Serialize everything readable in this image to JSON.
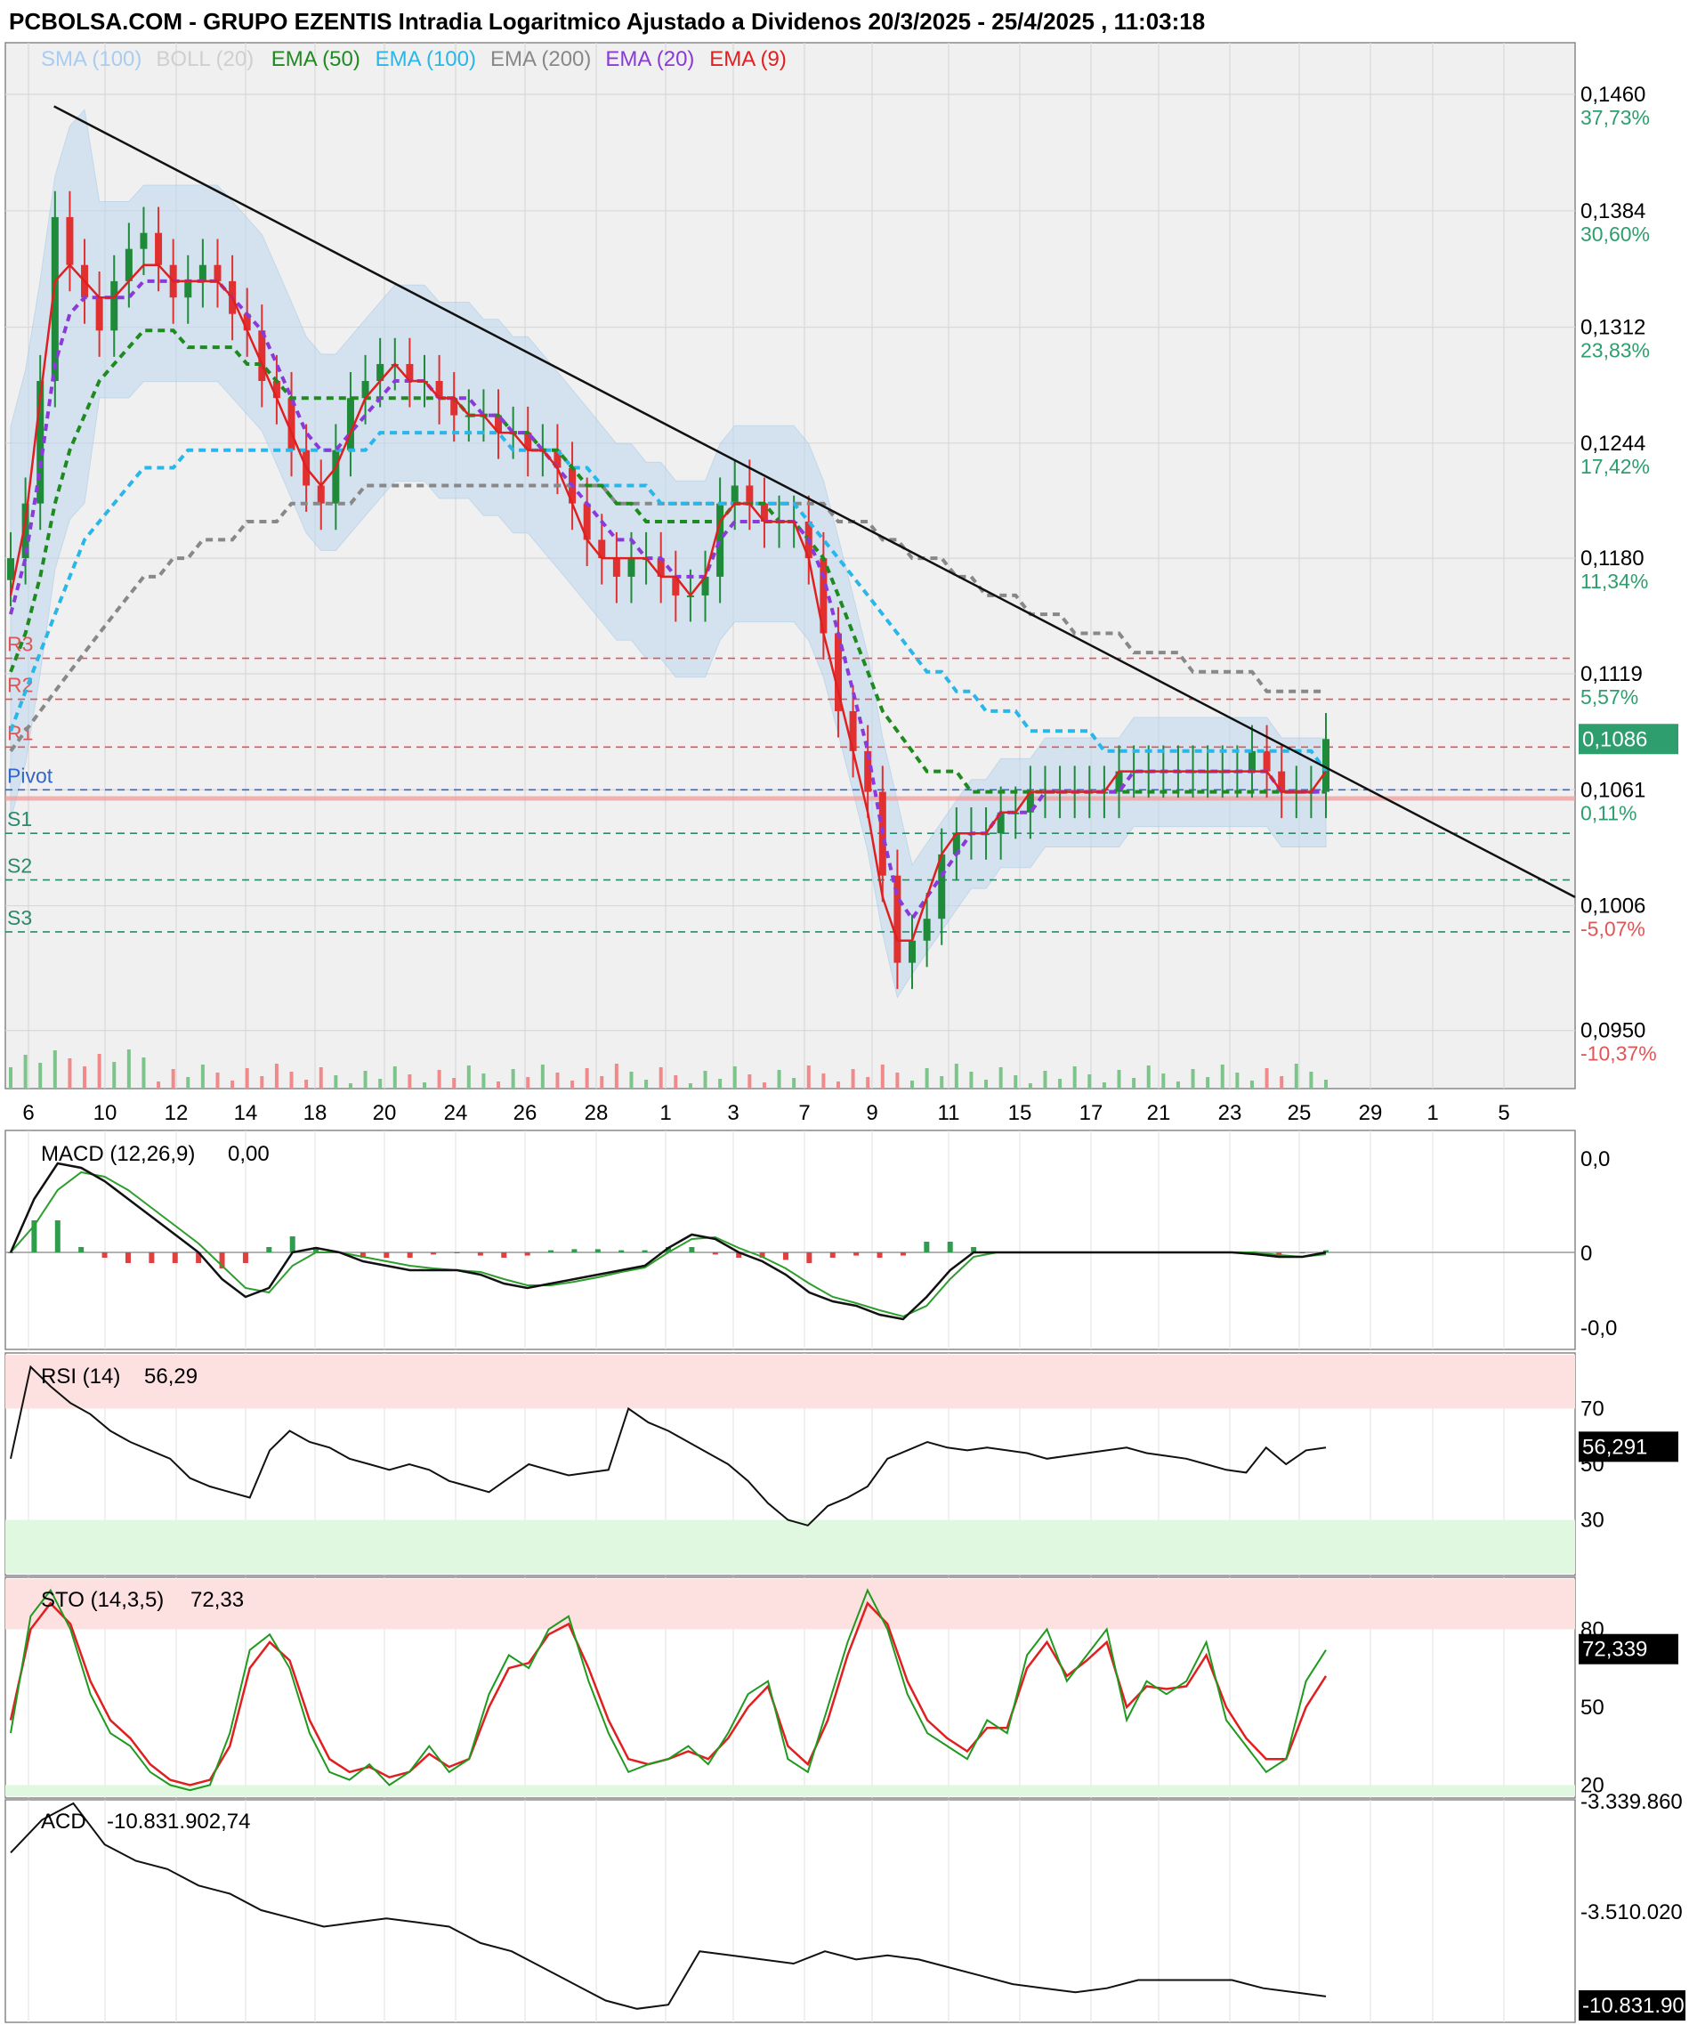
{
  "title": "PCBOLSA.COM - GRUPO EZENTIS Intradia Logaritmico Ajustado a Dividenos 20/3/2025 - 25/4/2025 , 11:03:18",
  "legend": [
    {
      "label": "SMA (100)",
      "color": "#a9cdf0"
    },
    {
      "label": "BOLL (20)",
      "color": "#cfcfcf"
    },
    {
      "label": "EMA (50)",
      "color": "#1f8a1f"
    },
    {
      "label": "EMA (100)",
      "color": "#29b6e8"
    },
    {
      "label": "EMA (200)",
      "color": "#888888"
    },
    {
      "label": "EMA (20)",
      "color": "#8a3ad8"
    },
    {
      "label": "EMA (9)",
      "color": "#e02020"
    }
  ],
  "colors": {
    "up": "#1f8a3a",
    "down": "#e03030",
    "badge": "#2e9e6e",
    "resistance": "#e05555",
    "support": "#2a8a6a",
    "pivot": "#3366cc"
  },
  "chart_data": [
    {
      "type": "candlestick",
      "name": "price",
      "scale": "log",
      "ylim": [
        0.0925,
        0.1495
      ],
      "x_ticks": [
        "6",
        "10",
        "12",
        "14",
        "18",
        "20",
        "24",
        "26",
        "28",
        "1",
        "3",
        "7",
        "9",
        "11",
        "15",
        "17",
        "21",
        "23",
        "25",
        "29",
        "1",
        "5"
      ],
      "y_ticks": [
        {
          "value": "0,1460",
          "pct": "37,73%"
        },
        {
          "value": "0,1384",
          "pct": "30,60%"
        },
        {
          "value": "0,1312",
          "pct": "23,83%"
        },
        {
          "value": "0,1244",
          "pct": "17,42%"
        },
        {
          "value": "0,1180",
          "pct": "11,34%"
        },
        {
          "value": "0,1119",
          "pct": "5,57%"
        },
        {
          "value": "0,1061",
          "pct": "0,11%"
        },
        {
          "value": "0,1006",
          "pct": "-5,07%"
        },
        {
          "value": "0,0950",
          "pct": "-10,37%"
        }
      ],
      "last_price": "0,1086",
      "pivot_levels": [
        {
          "label": "R3",
          "value": 0.1127
        },
        {
          "label": "R2",
          "value": 0.1106
        },
        {
          "label": "R1",
          "value": 0.1082
        },
        {
          "label": "Pivot",
          "value": 0.1061
        },
        {
          "label": "S1",
          "value": 0.104
        },
        {
          "label": "S2",
          "value": 0.1018
        },
        {
          "label": "S3",
          "value": 0.0994
        }
      ],
      "close": [
        0.118,
        0.121,
        0.128,
        0.138,
        0.135,
        0.133,
        0.131,
        0.134,
        0.136,
        0.137,
        0.135,
        0.133,
        0.134,
        0.135,
        0.134,
        0.132,
        0.131,
        0.128,
        0.127,
        0.124,
        0.122,
        0.121,
        0.124,
        0.127,
        0.128,
        0.129,
        0.129,
        0.128,
        0.128,
        0.127,
        0.126,
        0.126,
        0.126,
        0.125,
        0.125,
        0.124,
        0.124,
        0.123,
        0.121,
        0.119,
        0.118,
        0.117,
        0.118,
        0.118,
        0.117,
        0.116,
        0.116,
        0.117,
        0.121,
        0.122,
        0.121,
        0.12,
        0.12,
        0.12,
        0.118,
        0.114,
        0.11,
        0.108,
        0.106,
        0.102,
        0.098,
        0.099,
        0.1,
        0.103,
        0.104,
        0.104,
        0.104,
        0.105,
        0.105,
        0.106,
        0.106,
        0.106,
        0.106,
        0.106,
        0.106,
        0.107,
        0.107,
        0.107,
        0.107,
        0.107,
        0.107,
        0.107,
        0.107,
        0.107,
        0.108,
        0.107,
        0.106,
        0.106,
        0.106,
        0.1086
      ],
      "ema9": [
        0.116,
        0.12,
        0.127,
        0.134,
        0.135,
        0.134,
        0.133,
        0.133,
        0.134,
        0.135,
        0.135,
        0.134,
        0.134,
        0.134,
        0.134,
        0.133,
        0.131,
        0.129,
        0.127,
        0.125,
        0.123,
        0.122,
        0.123,
        0.125,
        0.127,
        0.128,
        0.129,
        0.128,
        0.128,
        0.127,
        0.127,
        0.126,
        0.126,
        0.125,
        0.125,
        0.124,
        0.124,
        0.123,
        0.121,
        0.119,
        0.118,
        0.118,
        0.118,
        0.118,
        0.117,
        0.117,
        0.116,
        0.117,
        0.12,
        0.121,
        0.121,
        0.12,
        0.12,
        0.12,
        0.118,
        0.114,
        0.111,
        0.108,
        0.105,
        0.101,
        0.099,
        0.099,
        0.101,
        0.103,
        0.104,
        0.104,
        0.104,
        0.105,
        0.105,
        0.106,
        0.106,
        0.106,
        0.106,
        0.106,
        0.106,
        0.107,
        0.107,
        0.107,
        0.107,
        0.107,
        0.107,
        0.107,
        0.107,
        0.107,
        0.107,
        0.107,
        0.106,
        0.106,
        0.106,
        0.107
      ],
      "ema20": [
        0.115,
        0.118,
        0.123,
        0.129,
        0.132,
        0.133,
        0.133,
        0.133,
        0.133,
        0.134,
        0.134,
        0.134,
        0.134,
        0.134,
        0.134,
        0.133,
        0.132,
        0.131,
        0.129,
        0.127,
        0.125,
        0.124,
        0.124,
        0.125,
        0.126,
        0.127,
        0.128,
        0.128,
        0.128,
        0.127,
        0.127,
        0.127,
        0.126,
        0.126,
        0.125,
        0.125,
        0.124,
        0.123,
        0.122,
        0.121,
        0.12,
        0.119,
        0.119,
        0.118,
        0.118,
        0.117,
        0.117,
        0.117,
        0.119,
        0.12,
        0.12,
        0.12,
        0.12,
        0.12,
        0.119,
        0.117,
        0.114,
        0.111,
        0.108,
        0.104,
        0.101,
        0.1,
        0.101,
        0.102,
        0.103,
        0.104,
        0.104,
        0.105,
        0.105,
        0.105,
        0.106,
        0.106,
        0.106,
        0.106,
        0.106,
        0.106,
        0.107,
        0.107,
        0.107,
        0.107,
        0.107,
        0.107,
        0.107,
        0.107,
        0.107,
        0.107,
        0.106,
        0.106,
        0.106,
        0.106
      ],
      "ema50": [
        0.112,
        0.114,
        0.117,
        0.121,
        0.124,
        0.126,
        0.128,
        0.129,
        0.13,
        0.131,
        0.131,
        0.131,
        0.13,
        0.13,
        0.13,
        0.13,
        0.129,
        0.129,
        0.128,
        0.127,
        0.127,
        0.127,
        0.127,
        0.127,
        0.127,
        0.127,
        0.127,
        0.127,
        0.127,
        0.127,
        0.127,
        0.126,
        0.126,
        0.126,
        0.125,
        0.125,
        0.124,
        0.124,
        0.123,
        0.122,
        0.122,
        0.121,
        0.121,
        0.12,
        0.12,
        0.12,
        0.12,
        0.12,
        0.12,
        0.121,
        0.121,
        0.121,
        0.12,
        0.12,
        0.119,
        0.118,
        0.116,
        0.114,
        0.112,
        0.11,
        0.109,
        0.108,
        0.107,
        0.107,
        0.107,
        0.106,
        0.106,
        0.106,
        0.106,
        0.106,
        0.106,
        0.106,
        0.106,
        0.106,
        0.106,
        0.106,
        0.106,
        0.106,
        0.106,
        0.106,
        0.106,
        0.106,
        0.106,
        0.106,
        0.106,
        0.106,
        0.106,
        0.106,
        0.106,
        0.106
      ],
      "ema100": [
        0.109,
        0.111,
        0.113,
        0.115,
        0.117,
        0.119,
        0.12,
        0.121,
        0.122,
        0.123,
        0.123,
        0.123,
        0.124,
        0.124,
        0.124,
        0.124,
        0.124,
        0.124,
        0.124,
        0.124,
        0.124,
        0.124,
        0.124,
        0.124,
        0.124,
        0.125,
        0.125,
        0.125,
        0.125,
        0.125,
        0.125,
        0.125,
        0.125,
        0.125,
        0.124,
        0.124,
        0.124,
        0.124,
        0.123,
        0.123,
        0.122,
        0.122,
        0.122,
        0.122,
        0.121,
        0.121,
        0.121,
        0.121,
        0.121,
        0.121,
        0.121,
        0.121,
        0.121,
        0.121,
        0.12,
        0.119,
        0.118,
        0.117,
        0.116,
        0.115,
        0.114,
        0.113,
        0.112,
        0.112,
        0.111,
        0.111,
        0.11,
        0.11,
        0.11,
        0.109,
        0.109,
        0.109,
        0.109,
        0.109,
        0.108,
        0.108,
        0.108,
        0.108,
        0.108,
        0.108,
        0.108,
        0.108,
        0.108,
        0.108,
        0.108,
        0.108,
        0.108,
        0.108,
        0.108,
        0.107
      ],
      "ema200": [
        0.108,
        0.109,
        0.11,
        0.111,
        0.112,
        0.113,
        0.114,
        0.115,
        0.116,
        0.117,
        0.117,
        0.118,
        0.118,
        0.119,
        0.119,
        0.119,
        0.12,
        0.12,
        0.12,
        0.121,
        0.121,
        0.121,
        0.121,
        0.121,
        0.122,
        0.122,
        0.122,
        0.122,
        0.122,
        0.122,
        0.122,
        0.122,
        0.122,
        0.122,
        0.122,
        0.122,
        0.122,
        0.122,
        0.122,
        0.122,
        0.122,
        0.121,
        0.121,
        0.121,
        0.121,
        0.121,
        0.121,
        0.121,
        0.121,
        0.121,
        0.121,
        0.121,
        0.121,
        0.121,
        0.121,
        0.121,
        0.12,
        0.12,
        0.12,
        0.119,
        0.119,
        0.118,
        0.118,
        0.118,
        0.117,
        0.117,
        0.116,
        0.116,
        0.116,
        0.115,
        0.115,
        0.115,
        0.114,
        0.114,
        0.114,
        0.114,
        0.113,
        0.113,
        0.113,
        0.113,
        0.112,
        0.112,
        0.112,
        0.112,
        0.112,
        0.111,
        0.111,
        0.111,
        0.111,
        0.111
      ],
      "trendline": [
        {
          "x": 0.031,
          "y": 0.1452
        },
        {
          "x": 1.0,
          "y": 0.101
        }
      ]
    },
    {
      "type": "line",
      "name": "MACD (12,26,9)",
      "value": "0,00",
      "y_ticks": [
        "0,0",
        "0",
        "-0,0"
      ],
      "macd": [
        0.0,
        0.6,
        1.0,
        0.95,
        0.8,
        0.6,
        0.4,
        0.2,
        0.0,
        -0.3,
        -0.5,
        -0.4,
        0.0,
        0.05,
        0.0,
        -0.1,
        -0.15,
        -0.2,
        -0.2,
        -0.2,
        -0.25,
        -0.35,
        -0.4,
        -0.35,
        -0.3,
        -0.25,
        -0.2,
        -0.15,
        0.05,
        0.2,
        0.15,
        0.0,
        -0.1,
        -0.25,
        -0.45,
        -0.55,
        -0.6,
        -0.7,
        -0.75,
        -0.5,
        -0.2,
        0.0,
        0.0,
        0.0,
        0.0,
        0.0,
        0.0,
        0.0,
        0.0,
        0.0,
        0.0,
        0.0,
        0.0,
        -0.02,
        -0.05,
        -0.05,
        0.0
      ],
      "signal": [
        0.0,
        0.3,
        0.7,
        0.9,
        0.85,
        0.7,
        0.5,
        0.3,
        0.1,
        -0.15,
        -0.4,
        -0.45,
        -0.15,
        0.0,
        0.0,
        -0.05,
        -0.1,
        -0.15,
        -0.18,
        -0.2,
        -0.22,
        -0.3,
        -0.37,
        -0.37,
        -0.33,
        -0.28,
        -0.22,
        -0.17,
        0.0,
        0.15,
        0.17,
        0.05,
        -0.05,
        -0.18,
        -0.35,
        -0.5,
        -0.57,
        -0.65,
        -0.72,
        -0.6,
        -0.3,
        -0.05,
        0.0,
        0.0,
        0.0,
        0.0,
        0.0,
        0.0,
        0.0,
        0.0,
        0.0,
        0.0,
        0.0,
        0.0,
        -0.03,
        -0.05,
        -0.02
      ]
    },
    {
      "type": "line",
      "name": "RSI (14)",
      "value": "56,29",
      "last": "56,291",
      "ylim": [
        10,
        90
      ],
      "y_ticks": [
        "70",
        "50",
        "30"
      ],
      "values": [
        52,
        85,
        78,
        72,
        68,
        62,
        58,
        55,
        52,
        45,
        42,
        40,
        38,
        55,
        62,
        58,
        56,
        52,
        50,
        48,
        50,
        48,
        44,
        42,
        40,
        45,
        50,
        48,
        46,
        47,
        48,
        70,
        65,
        62,
        58,
        54,
        50,
        44,
        36,
        30,
        28,
        35,
        38,
        42,
        52,
        55,
        58,
        56,
        55,
        56,
        55,
        54,
        52,
        53,
        54,
        55,
        56,
        54,
        53,
        52,
        50,
        48,
        47,
        56,
        50,
        55,
        56
      ]
    },
    {
      "type": "line",
      "name": "STO (14,3,5)",
      "value": "72,33",
      "last": "72,339",
      "ylim": [
        15,
        100
      ],
      "y_ticks": [
        "80",
        "50",
        "20"
      ],
      "k": [
        40,
        85,
        95,
        80,
        55,
        40,
        35,
        25,
        20,
        18,
        20,
        40,
        72,
        78,
        65,
        40,
        25,
        22,
        28,
        20,
        25,
        35,
        25,
        30,
        55,
        70,
        65,
        80,
        85,
        60,
        40,
        25,
        28,
        30,
        35,
        28,
        40,
        55,
        60,
        30,
        25,
        50,
        75,
        95,
        80,
        55,
        40,
        35,
        30,
        45,
        40,
        70,
        80,
        60,
        70,
        80,
        45,
        60,
        55,
        60,
        75,
        45,
        35,
        25,
        30,
        60,
        72
      ],
      "d": [
        45,
        80,
        90,
        82,
        60,
        45,
        38,
        28,
        22,
        20,
        22,
        35,
        65,
        75,
        68,
        45,
        30,
        25,
        27,
        23,
        25,
        32,
        27,
        30,
        50,
        65,
        67,
        78,
        82,
        65,
        45,
        30,
        28,
        30,
        33,
        30,
        38,
        50,
        58,
        35,
        28,
        45,
        70,
        90,
        82,
        60,
        45,
        38,
        33,
        42,
        42,
        65,
        75,
        62,
        68,
        75,
        50,
        58,
        57,
        58,
        70,
        50,
        38,
        30,
        30,
        50,
        62
      ]
    },
    {
      "type": "line",
      "name": "ACD",
      "value": "-10.831.902,74",
      "y_ticks": [
        "-3.339.860",
        "-3.510.020",
        "-10.831.90"
      ],
      "last": "-10.831.90",
      "values": [
        -3.4,
        -3.0,
        -2.8,
        -3.3,
        -3.5,
        -3.6,
        -3.8,
        -3.9,
        -4.1,
        -4.2,
        -4.3,
        -4.25,
        -4.2,
        -4.25,
        -4.3,
        -4.5,
        -4.6,
        -4.8,
        -5.0,
        -5.2,
        -5.3,
        -5.25,
        -4.6,
        -4.65,
        -4.7,
        -4.75,
        -4.6,
        -4.7,
        -4.65,
        -4.7,
        -4.8,
        -4.9,
        -5.0,
        -5.05,
        -5.1,
        -5.05,
        -4.95,
        -4.95,
        -4.95,
        -4.95,
        -5.05,
        -5.1,
        -5.15
      ]
    }
  ]
}
